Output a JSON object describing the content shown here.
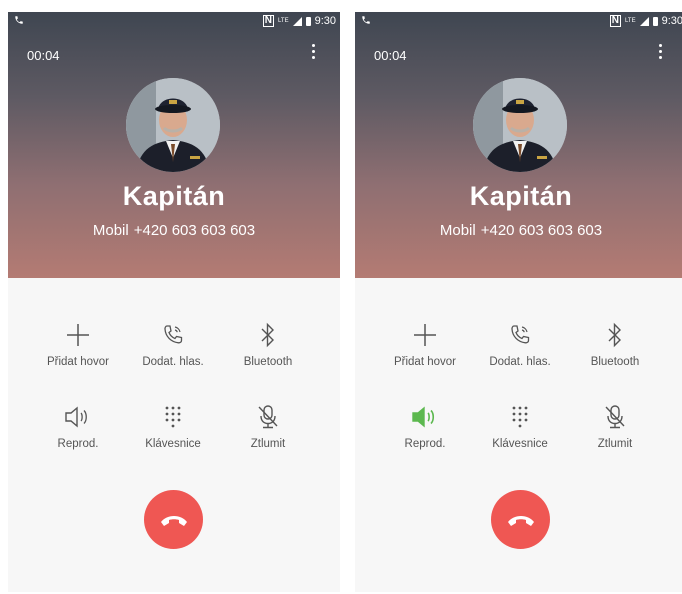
{
  "panels": [
    {
      "status": {
        "time": "9:30",
        "nfc": "N",
        "network": "LTE"
      },
      "call": {
        "duration": "00:04",
        "name": "Kapitán",
        "number_label": "Mobil",
        "number": "+420 603 603 603"
      },
      "controls": [
        {
          "label": "Přidat hovor",
          "icon": "add-icon"
        },
        {
          "label": "Dodat. hlas.",
          "icon": "voice-call-icon"
        },
        {
          "label": "Bluetooth",
          "icon": "bluetooth-icon"
        },
        {
          "label": "Reprod.",
          "icon": "speaker-icon",
          "active": false
        },
        {
          "label": "Klávesnice",
          "icon": "dialpad-icon"
        },
        {
          "label": "Ztlumit",
          "icon": "mute-microphone-icon"
        }
      ]
    },
    {
      "status": {
        "time": "9:30",
        "nfc": "N",
        "network": "LTE"
      },
      "call": {
        "duration": "00:04",
        "name": "Kapitán",
        "number_label": "Mobil",
        "number": "+420 603 603 603"
      },
      "controls": [
        {
          "label": "Přidat hovor",
          "icon": "add-icon"
        },
        {
          "label": "Dodat. hlas.",
          "icon": "voice-call-icon"
        },
        {
          "label": "Bluetooth",
          "icon": "bluetooth-icon"
        },
        {
          "label": "Reprod.",
          "icon": "speaker-icon",
          "active": true
        },
        {
          "label": "Klávesnice",
          "icon": "dialpad-icon"
        },
        {
          "label": "Ztlumit",
          "icon": "mute-microphone-icon"
        }
      ]
    }
  ],
  "colors": {
    "end_call": "#ef5753",
    "speaker_active": "#5cb84f",
    "icon_default": "#555555"
  }
}
